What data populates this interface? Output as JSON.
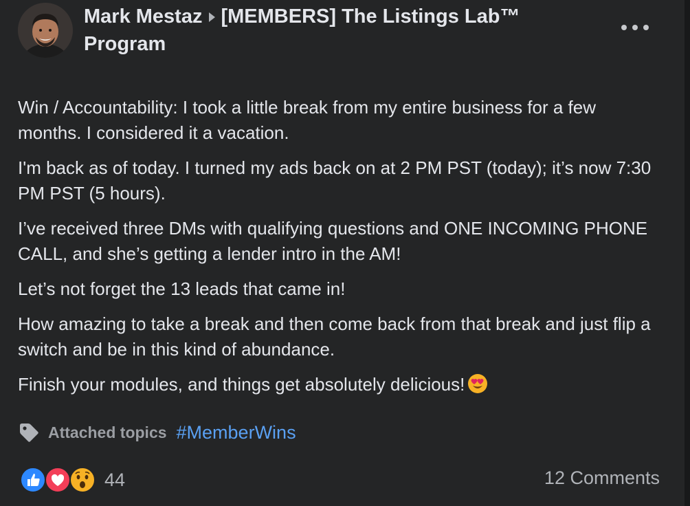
{
  "header": {
    "author": "Mark Mestaz",
    "group_line1": "[MEMBERS] The Listings Lab™",
    "group_line2": "Program"
  },
  "post": {
    "paragraphs": [
      "Win / Accountability: I took a little break from my entire business for a few months. I considered it a vacation.",
      "I'm back as of today. I turned my ads back on at 2 PM PST (today); it’s now 7:30 PM PST (5 hours).",
      "I’ve received three DMs with qualifying questions and ONE INCOMING PHONE CALL, and she’s getting a lender intro in the AM!",
      "Let’s not forget the 13 leads that came in!",
      "How amazing to take a break and then come back from that break and just flip a switch and be in this kind of abundance.",
      "Finish your modules, and things get absolutely delicious!"
    ],
    "final_emoji": "smiling-face-with-heart-eyes"
  },
  "topics": {
    "label": "Attached topics",
    "hashtag": "#MemberWins"
  },
  "reactions": {
    "types": [
      "like",
      "love",
      "wow"
    ],
    "count": "44"
  },
  "comments": {
    "label": "12 Comments"
  },
  "colors": {
    "background": "#242526",
    "text": "#e4e6eb",
    "muted": "#b0b3b8",
    "link": "#5aa0f2",
    "like": "#2d88ff",
    "love": "#f33e58",
    "wow": "#f7b125"
  }
}
